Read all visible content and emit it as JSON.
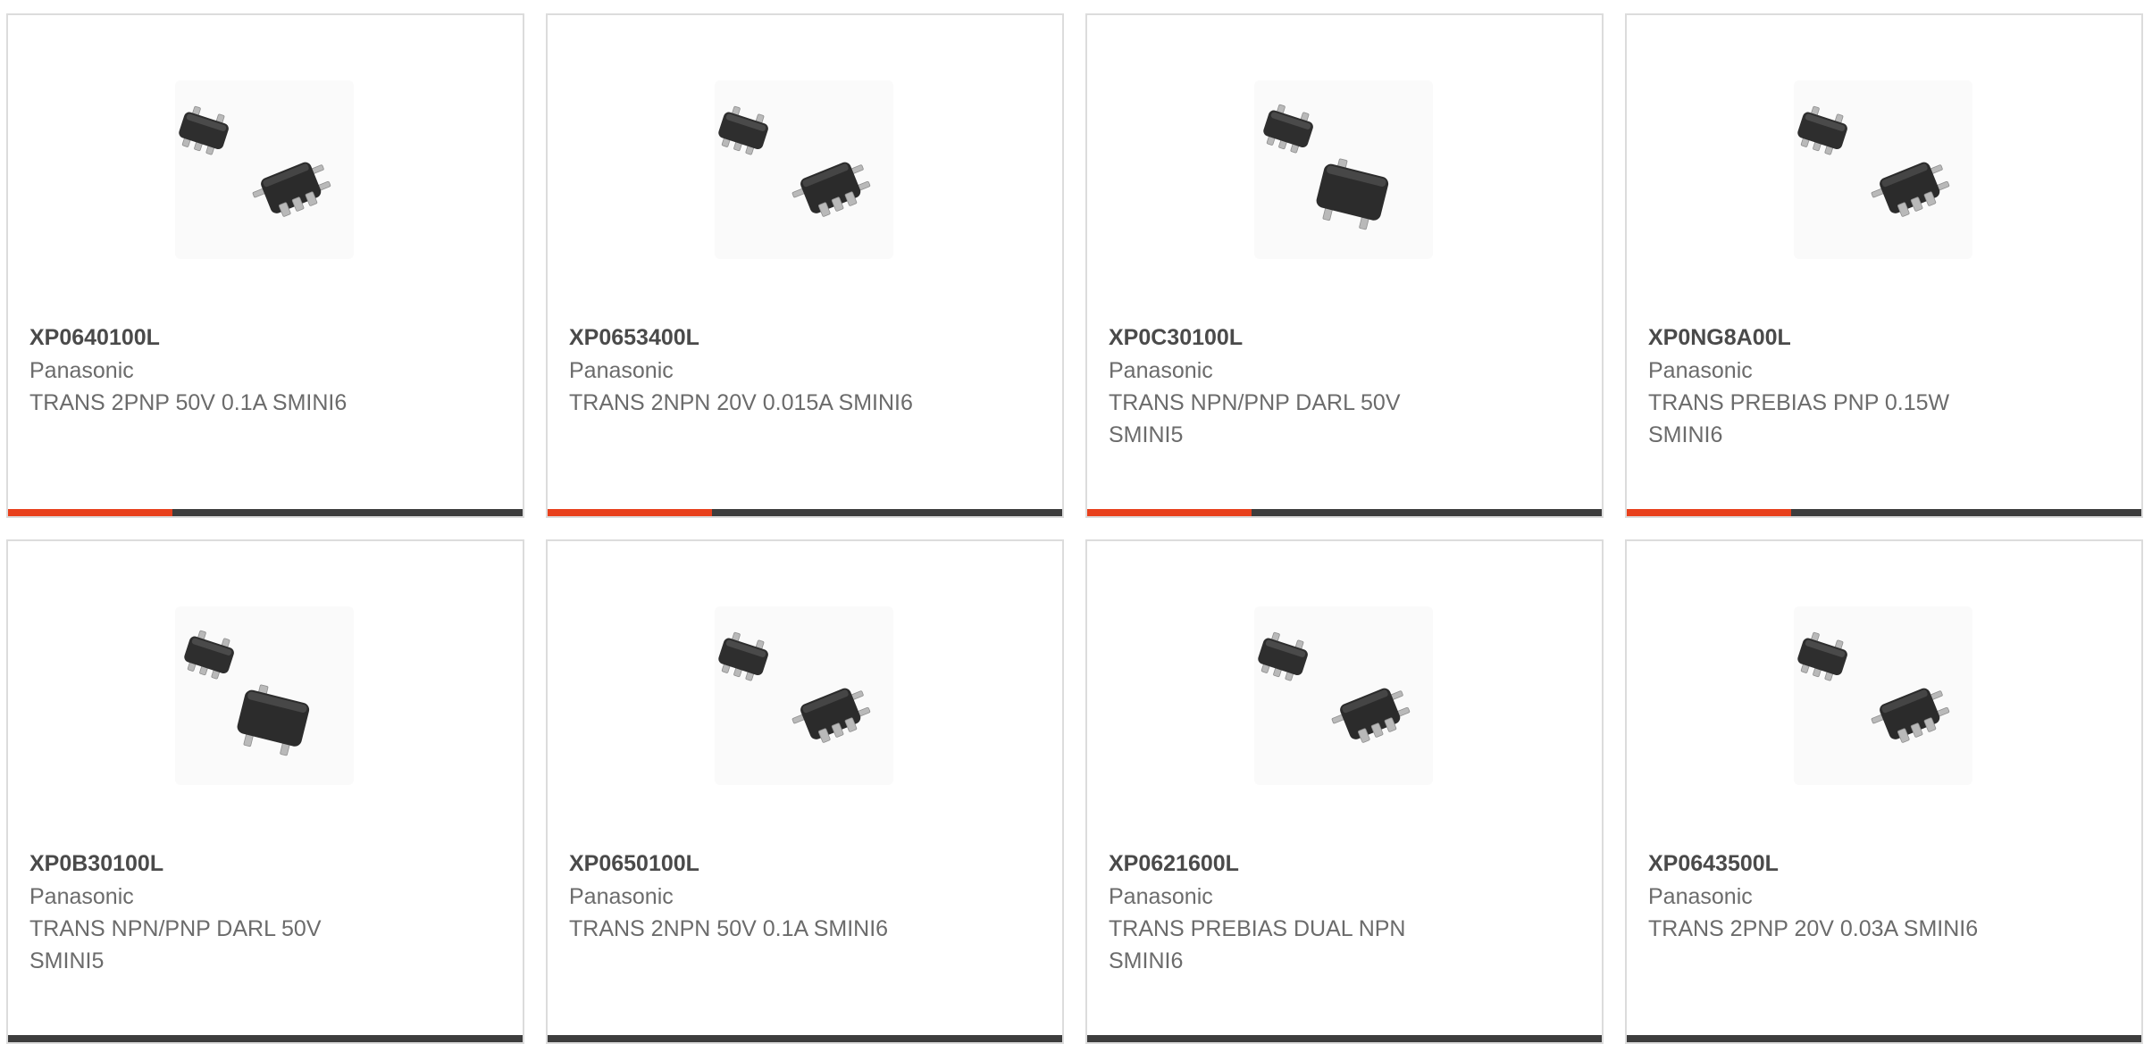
{
  "colors": {
    "accent": "#e8401c",
    "bar_dark": "#3d3d3d",
    "card_border": "#dcdcdc",
    "part_number_text": "#4a4a4a",
    "secondary_text": "#6b6b6b"
  },
  "products": [
    {
      "part_number": "XP0640100L",
      "manufacturer": "Panasonic",
      "description": "TRANS 2PNP 50V 0.1A SMINI6",
      "image_icon": "sot363-six-lead-package-icon",
      "accent_progress": 0.32
    },
    {
      "part_number": "XP0653400L",
      "manufacturer": "Panasonic",
      "description": "TRANS 2NPN 20V 0.015A SMINI6",
      "image_icon": "sot363-six-lead-package-icon",
      "accent_progress": 0.32
    },
    {
      "part_number": "XP0C30100L",
      "manufacturer": "Panasonic",
      "description": "TRANS NPN/PNP DARL 50V SMINI5",
      "image_icon": "sot353-five-lead-package-icon",
      "accent_progress": 0.32
    },
    {
      "part_number": "XP0NG8A00L",
      "manufacturer": "Panasonic",
      "description": "TRANS PREBIAS PNP 0.15W SMINI6",
      "image_icon": "sot363-six-lead-package-icon",
      "accent_progress": 0.32
    },
    {
      "part_number": "XP0B30100L",
      "manufacturer": "Panasonic",
      "description": "TRANS NPN/PNP DARL 50V SMINI5",
      "image_icon": "sot353-five-lead-package-icon",
      "accent_progress": 0
    },
    {
      "part_number": "XP0650100L",
      "manufacturer": "Panasonic",
      "description": "TRANS 2NPN 50V 0.1A SMINI6",
      "image_icon": "sot363-six-lead-package-icon",
      "accent_progress": 0
    },
    {
      "part_number": "XP0621600L",
      "manufacturer": "Panasonic",
      "description": "TRANS PREBIAS DUAL NPN SMINI6",
      "image_icon": "sot363-six-lead-package-icon",
      "accent_progress": 0
    },
    {
      "part_number": "XP0643500L",
      "manufacturer": "Panasonic",
      "description": "TRANS 2PNP 20V 0.03A SMINI6",
      "image_icon": "sot363-six-lead-package-icon",
      "accent_progress": 0
    }
  ]
}
